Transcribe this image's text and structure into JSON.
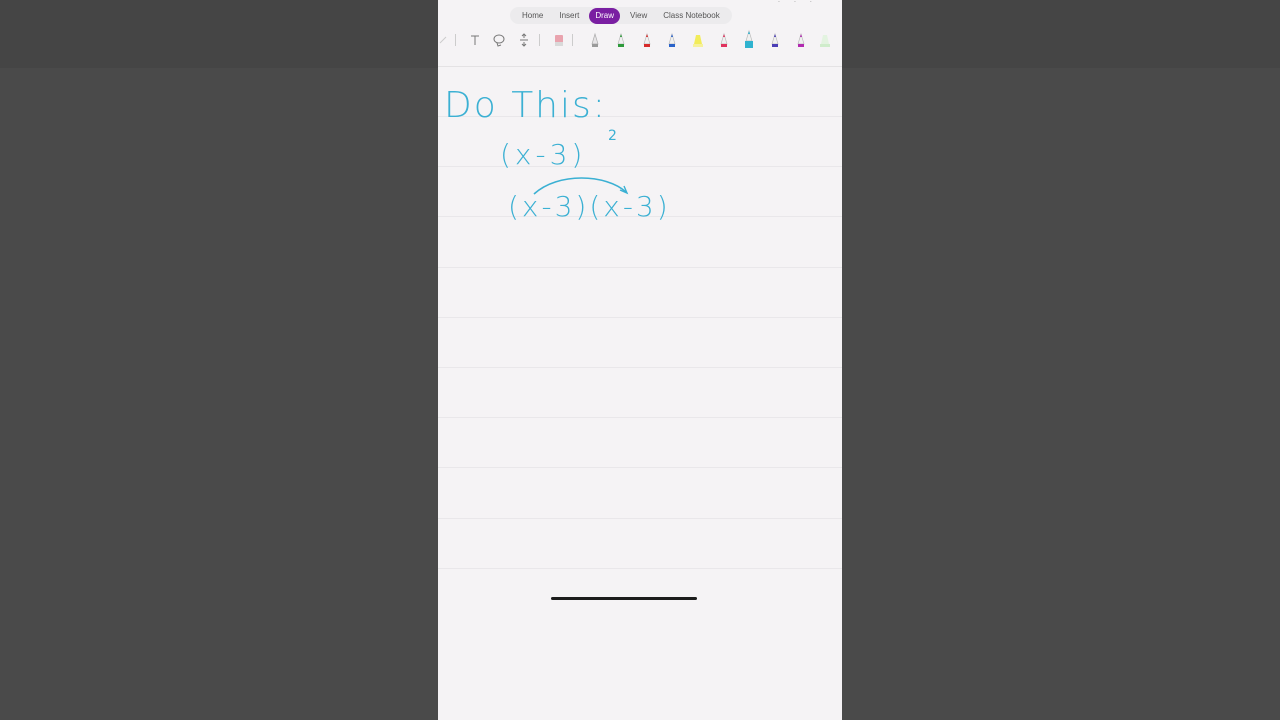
{
  "ribbon": {
    "tabs": [
      {
        "label": "Home"
      },
      {
        "label": "Insert"
      },
      {
        "label": "Draw"
      },
      {
        "label": "View"
      },
      {
        "label": "Class Notebook"
      }
    ],
    "active_tab": "Draw",
    "accent": "#7a1fa2"
  },
  "tools": {
    "items": [
      "lasso-icon",
      "type-text-icon",
      "lasso-select-icon",
      "insert-space-icon",
      "eraser-icon"
    ],
    "pens": [
      {
        "name": "pencil-pen",
        "color": "#9a9a9a"
      },
      {
        "name": "green-pen",
        "color": "#2e9a3c"
      },
      {
        "name": "red-pen",
        "color": "#d62a2a"
      },
      {
        "name": "blue-pen",
        "color": "#2b63c9"
      },
      {
        "name": "yellow-highlighter",
        "color": "#f2ec5a"
      },
      {
        "name": "pink-pen",
        "color": "#e0335e"
      },
      {
        "name": "cyan-pen",
        "color": "#2fb2cf"
      },
      {
        "name": "purple-pen",
        "color": "#4a3db5"
      },
      {
        "name": "magenta-pen",
        "color": "#b22ab0"
      },
      {
        "name": "light-green-highlighter",
        "color": "#cfeccb"
      }
    ]
  },
  "page": {
    "ink_color": "#3bb0d3",
    "handwriting": {
      "line1": "Do This:",
      "line2": "(x-3)",
      "line2_exponent": "2",
      "line3": "(x-3)(x-3)"
    }
  }
}
